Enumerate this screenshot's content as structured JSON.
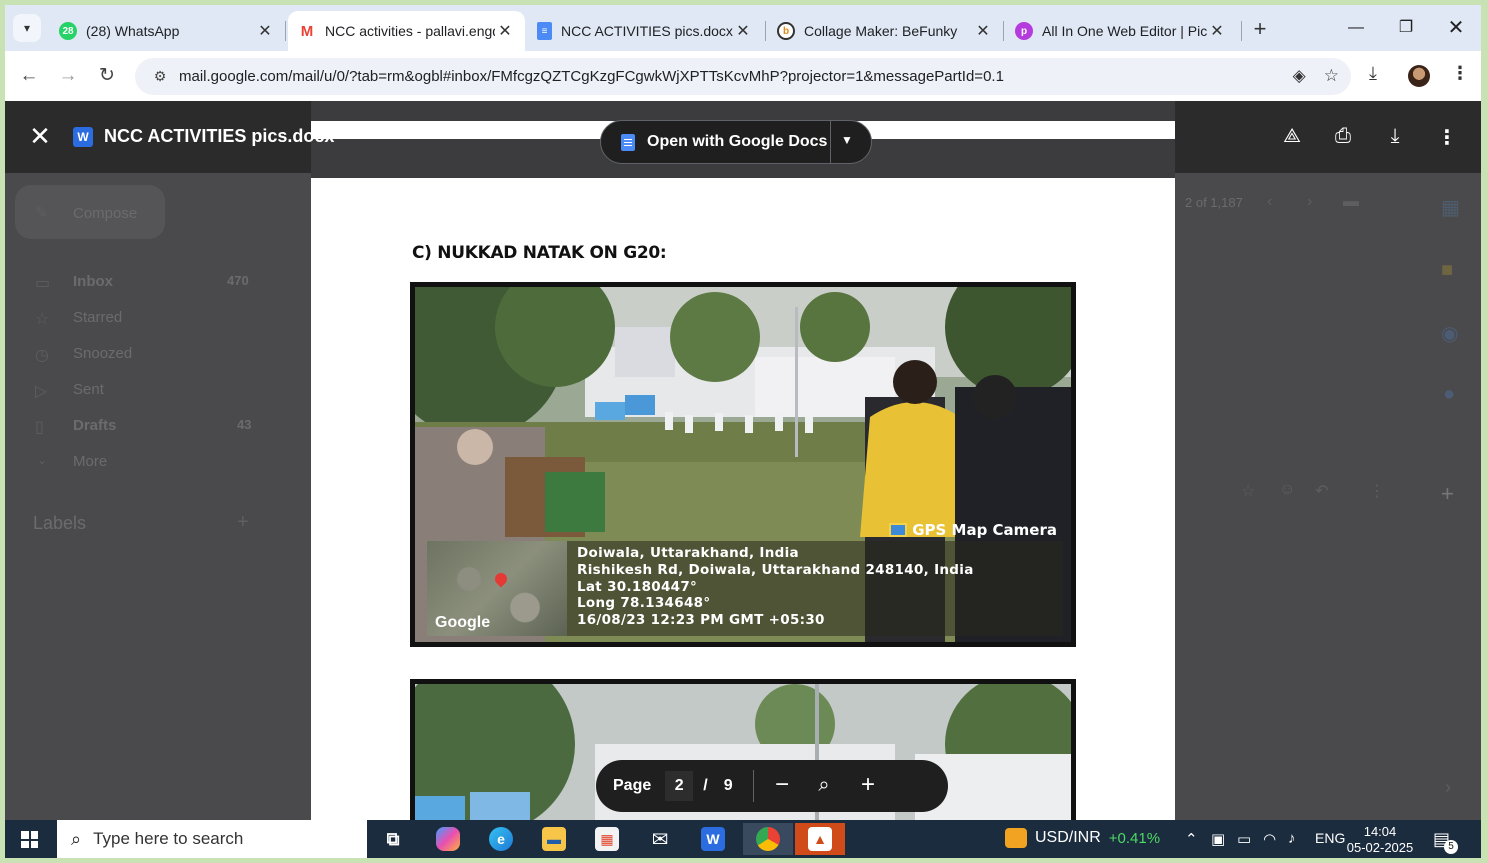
{
  "browser": {
    "tabs": [
      {
        "title": "(28) WhatsApp",
        "favicon": "whatsapp-icon",
        "badge": "28",
        "color": "#25d366"
      },
      {
        "title": "NCC activities - pallavi.engd",
        "favicon": "gmail-icon",
        "color": "#ea4335"
      },
      {
        "title": "NCC ACTIVITIES pics.docx - ",
        "favicon": "docs-icon",
        "color": "#4c8bf5"
      },
      {
        "title": "Collage Maker: BeFunky",
        "favicon": "befunky-icon",
        "color": "#333333"
      },
      {
        "title": "All In One Web Editor | Picsa",
        "favicon": "picsart-icon",
        "color": "#b43cdc"
      }
    ],
    "url": "mail.google.com/mail/u/0/?tab=rm&ogbl#inbox/FMfcgzQZTCgKzgFCgwkWjXPTTsKcvMhP?projector=1&messagePartId=0.1"
  },
  "gmail_background": {
    "compose": "Compose",
    "folders": [
      {
        "label": "Inbox",
        "count": "470"
      },
      {
        "label": "Starred"
      },
      {
        "label": "Snoozed"
      },
      {
        "label": "Sent"
      },
      {
        "label": "Drafts",
        "count": "43"
      },
      {
        "label": "More"
      }
    ],
    "labels_heading": "Labels",
    "pagination": "2 of 1,187"
  },
  "viewer": {
    "file_name": "NCC ACTIVITIES pics.docx",
    "open_with": "Open with Google Docs"
  },
  "document": {
    "heading": "C) NUKKAD NATAK ON G20:",
    "photo_overlay": {
      "badge": "GPS Map Camera",
      "map_label": "Google",
      "lines": [
        "Doiwala, Uttarakhand, India",
        "Rishikesh Rd, Doiwala, Uttarakhand 248140, India",
        "Lat 30.180447°",
        "Long 78.134648°",
        "16/08/23 12:23 PM GMT +05:30"
      ]
    }
  },
  "page_control": {
    "label": "Page",
    "current": "2",
    "separator": "/",
    "total": "9"
  },
  "taskbar": {
    "search_placeholder": "Type here to search",
    "fx_pair": "USD/INR",
    "fx_change": "+0.41%",
    "language": "ENG",
    "time": "14:04",
    "date": "05-02-2025",
    "notifications": "5"
  }
}
